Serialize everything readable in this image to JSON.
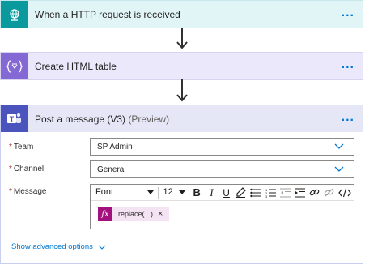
{
  "flow": {
    "trigger": {
      "title": "When a HTTP request is received",
      "more_label": "..."
    },
    "create_table": {
      "title": "Create HTML table",
      "more_label": "..."
    },
    "teams": {
      "title": "Post a message (V3)",
      "subtitle": "(Preview)",
      "more_label": "...",
      "fields": {
        "team": {
          "label": "Team",
          "required_mark": "*",
          "value": "SP Admin"
        },
        "channel": {
          "label": "Channel",
          "required_mark": "*",
          "value": "General"
        },
        "message": {
          "label": "Message",
          "required_mark": "*",
          "toolbar": {
            "font": "Font",
            "size": "12",
            "bold": "B",
            "italic": "I",
            "underline": "U"
          },
          "token": {
            "icon_text": "fx",
            "label": "replace(...)",
            "remove": "×"
          }
        }
      },
      "advanced_options": "Show advanced options"
    }
  },
  "colors": {
    "trigger_icon": "#0a9a9e",
    "create_icon": "#8468d4",
    "teams_icon": "#4b53bc",
    "expression_token": "#a4107e",
    "link": "#0078d4"
  },
  "icons": {
    "trigger": "http-globe-icon",
    "create": "variable-braces-icon",
    "teams": "microsoft-teams-icon"
  }
}
